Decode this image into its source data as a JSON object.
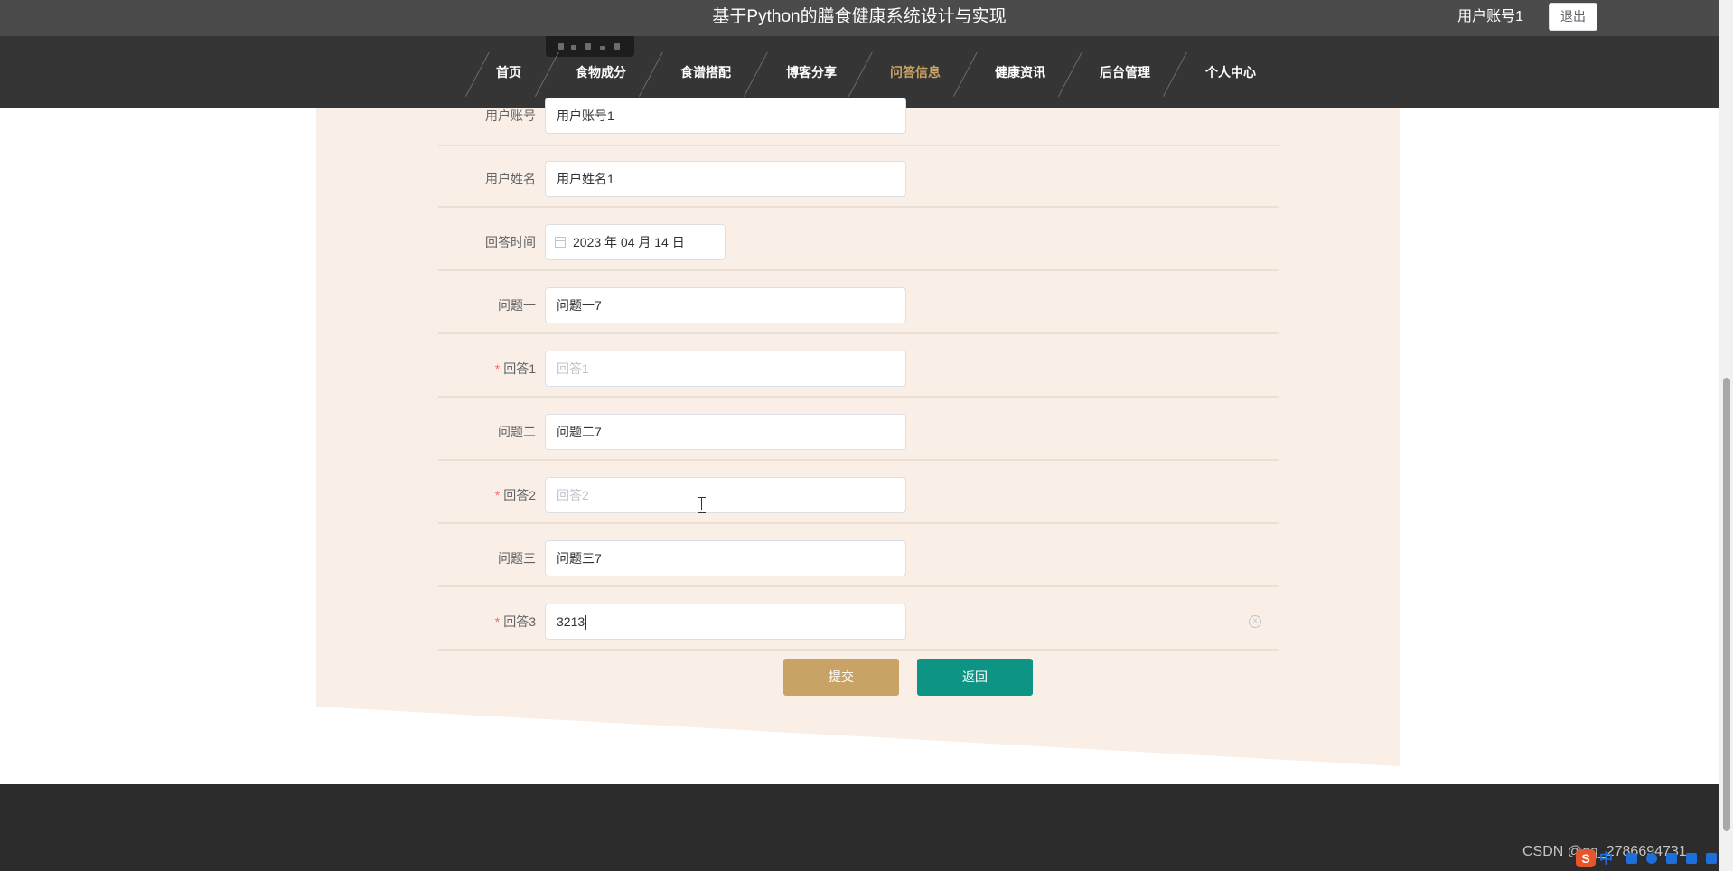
{
  "header": {
    "title": "基于Python的膳食健康系统设计与实现",
    "user_label": "用户账号1",
    "logout_label": "退出"
  },
  "nav": {
    "items": [
      {
        "label": "首页"
      },
      {
        "label": "食物成分"
      },
      {
        "label": "食谱搭配"
      },
      {
        "label": "博客分享"
      },
      {
        "label": "问答信息",
        "active": true
      },
      {
        "label": "健康资讯"
      },
      {
        "label": "后台管理"
      },
      {
        "label": "个人中心"
      }
    ]
  },
  "form": {
    "fields": [
      {
        "label": "用户账号",
        "value": "用户账号1",
        "required": false
      },
      {
        "label": "用户姓名",
        "value": "用户姓名1",
        "required": false
      },
      {
        "label": "回答时间",
        "value": "2023 年 04 月 14 日",
        "required": false,
        "type": "date"
      },
      {
        "label": "问题一",
        "value": "问题一7",
        "required": false
      },
      {
        "label": "回答1",
        "value": "",
        "placeholder": "回答1",
        "required": true
      },
      {
        "label": "问题二",
        "value": "问题二7",
        "required": false
      },
      {
        "label": "回答2",
        "value": "",
        "placeholder": "回答2",
        "required": true
      },
      {
        "label": "问题三",
        "value": "问题三7",
        "required": false
      },
      {
        "label": "回答3",
        "value": "3213",
        "required": true,
        "focused": true
      }
    ],
    "required_mark": "*",
    "submit_label": "提交",
    "back_label": "返回"
  },
  "footer": {
    "watermark": "CSDN @qq_2786694731"
  },
  "ime": {
    "logo": "S",
    "mode": "中"
  },
  "colors": {
    "topbar": "#4b4b4b",
    "navbar": "#353535",
    "nav_active": "#c9a265",
    "panel_bg": "#f9efe6",
    "submit": "#c9a265",
    "back": "#0e9484",
    "footer": "#2c2c2c",
    "required": "#f56c6c"
  },
  "icons": [
    "calendar-icon",
    "circle-close-icon",
    "text-cursor-icon"
  ]
}
